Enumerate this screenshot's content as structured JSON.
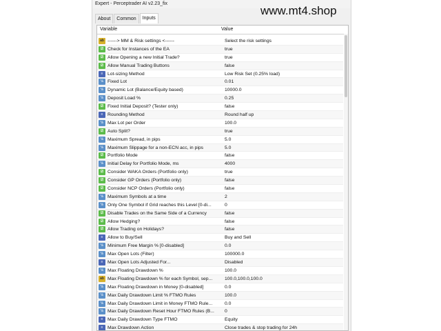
{
  "window": {
    "title": "Expert - Perceptrader AI v2.23_fix"
  },
  "watermark": "www.mt4.shop",
  "tabs": [
    {
      "label": "About"
    },
    {
      "label": "Common"
    },
    {
      "label": "Inputs"
    }
  ],
  "table": {
    "col_variable": "Variable",
    "col_value": "Value",
    "rows": [
      {
        "icon": "str",
        "name": "------> MM & Risk settings <------",
        "value": "Select the risk settings"
      },
      {
        "icon": "bool",
        "name": "Check for Instances of the EA",
        "value": "true"
      },
      {
        "icon": "bool",
        "name": "Allow Opening a new Initial Trade?",
        "value": "true"
      },
      {
        "icon": "bool",
        "name": "Allow Manual Trading Buttons",
        "value": "false"
      },
      {
        "icon": "enum",
        "name": "Lot-sizing Method",
        "value": "Low Risk Set (0.25% load)"
      },
      {
        "icon": "num",
        "name": "Fixed Lot",
        "value": "0.01"
      },
      {
        "icon": "num",
        "name": "Dynamic Lot (Balance/Equity based)",
        "value": "10000.0"
      },
      {
        "icon": "num",
        "name": "Deposit Load %",
        "value": "0.25"
      },
      {
        "icon": "bool",
        "name": "Fixed Initial Deposit? (Tester only)",
        "value": "false"
      },
      {
        "icon": "enum",
        "name": "Rounding Method",
        "value": "Round half up"
      },
      {
        "icon": "num",
        "name": "Max Lot per Order",
        "value": "100.0"
      },
      {
        "icon": "bool",
        "name": "Auto Split?",
        "value": "true"
      },
      {
        "icon": "num",
        "name": "Maximum Spread, in pips",
        "value": "5.0"
      },
      {
        "icon": "num",
        "name": "Maximum Slippage for a non-ECN acc, in pips",
        "value": "5.0"
      },
      {
        "icon": "bool",
        "name": "Portfolio Mode",
        "value": "false"
      },
      {
        "icon": "num",
        "name": "Initial Delay for Portfolio Mode, ms",
        "value": "4000"
      },
      {
        "icon": "bool",
        "name": "Consider WAKA Orders (Portfolio only)",
        "value": "true"
      },
      {
        "icon": "bool",
        "name": "Consider GP Orders (Portfolio only)",
        "value": "false"
      },
      {
        "icon": "bool",
        "name": "Consider NCP Orders (Portfolio only)",
        "value": "false"
      },
      {
        "icon": "num",
        "name": "Maximum Symbols at a time",
        "value": "2"
      },
      {
        "icon": "num",
        "name": "Only One Symbol if Grid reaches this Level [0-di...",
        "value": "0"
      },
      {
        "icon": "bool",
        "name": "Disable Trades on the Same Side of a Currency",
        "value": "false"
      },
      {
        "icon": "bool",
        "name": "Allow Hedging?",
        "value": "false"
      },
      {
        "icon": "bool",
        "name": "Allow Trading on Holidays?",
        "value": "false"
      },
      {
        "icon": "enum",
        "name": "Allow to Buy/Sell",
        "value": "Buy and Sell"
      },
      {
        "icon": "num",
        "name": "Minimum Free Margin % [0-disabled]",
        "value": "0.0"
      },
      {
        "icon": "num",
        "name": "Max Open Lots (Filter)",
        "value": "100000.0"
      },
      {
        "icon": "enum",
        "name": "Max Open Lots Adjusted For...",
        "value": "Disabled"
      },
      {
        "icon": "num",
        "name": "Max Floating Drawdown %",
        "value": "100.0"
      },
      {
        "icon": "str",
        "name": "Max Floating Drawdown % for each Symbol, sep...",
        "value": "100.0,100.0,100.0"
      },
      {
        "icon": "num",
        "name": "Max Floating Drawdown in Money [0-disabled]",
        "value": "0.0"
      },
      {
        "icon": "num",
        "name": "Max Daily Drawdown Limit % FTMO Rules",
        "value": "100.0"
      },
      {
        "icon": "num",
        "name": "Max Daily Drawdown Limit in Money FTMO Rule...",
        "value": "0.0"
      },
      {
        "icon": "num",
        "name": "Max Daily Drawdown Reset Hour FTMO Rules (B...",
        "value": "0"
      },
      {
        "icon": "enum",
        "name": "Max Daily Drawdown Type FTMO",
        "value": "Equity"
      },
      {
        "icon": "enum",
        "name": "Max Drawdown Action",
        "value": "Close trades & stop trading for 24h"
      }
    ]
  }
}
